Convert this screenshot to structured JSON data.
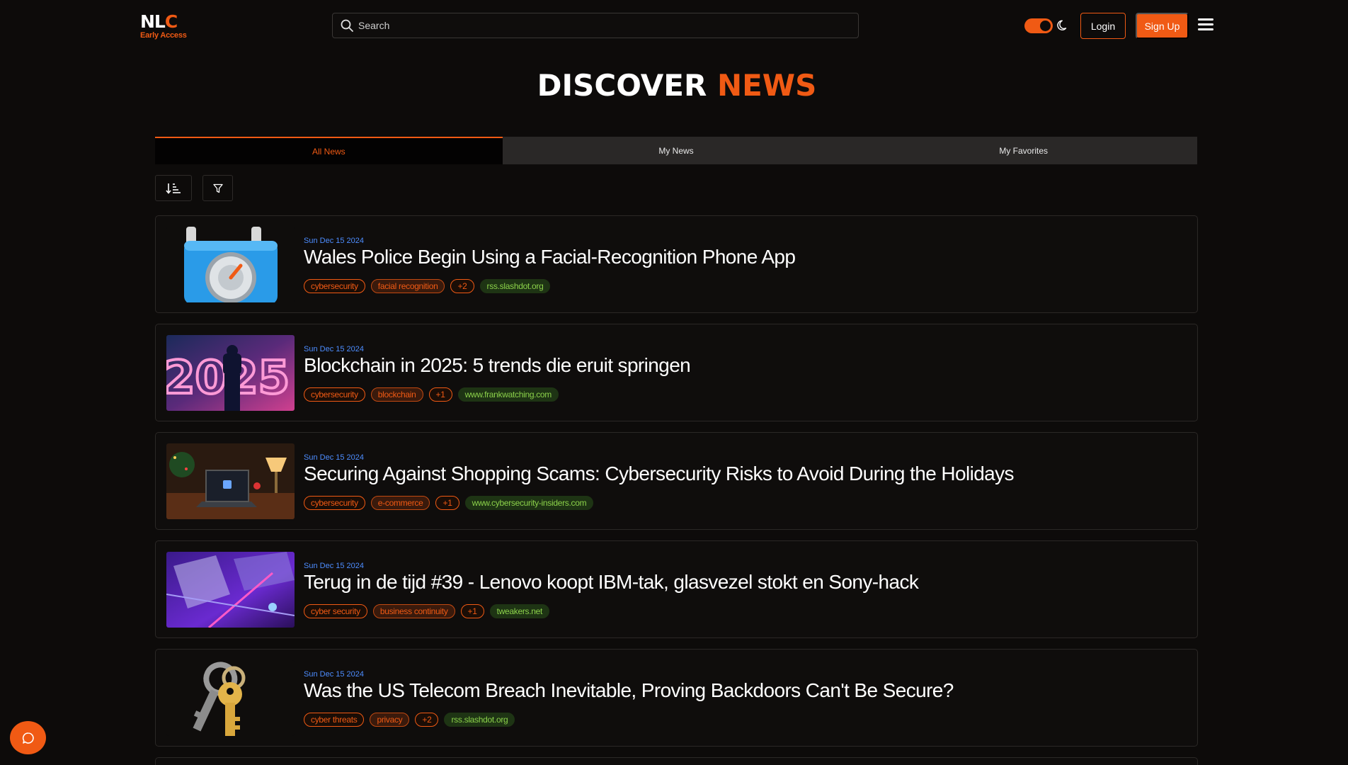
{
  "header": {
    "logo_main_1": "NL",
    "logo_main_2": "C",
    "logo_sub": "Early Access",
    "search_placeholder": "Search",
    "login_label": "Login",
    "signup_label": "Sign Up"
  },
  "page": {
    "title_1": "DISCOVER",
    "title_2": "NEWS"
  },
  "tabs": [
    {
      "label": "All News",
      "active": true
    },
    {
      "label": "My News",
      "active": false
    },
    {
      "label": "My Favorites",
      "active": false
    }
  ],
  "articles": [
    {
      "date": "Sun Dec 15 2024",
      "title": "Wales Police Begin Using a Facial-Recognition Phone App",
      "tags": [
        "cybersecurity",
        "facial recognition"
      ],
      "more": "+2",
      "source": "rss.slashdot.org",
      "thumb": "padlock-icon"
    },
    {
      "date": "Sun Dec 15 2024",
      "title": "Blockchain in 2025: 5 trends die eruit springen",
      "tags": [
        "cybersecurity",
        "blockchain"
      ],
      "more": "+1",
      "source": "www.frankwatching.com",
      "thumb": "2025-neon-photo"
    },
    {
      "date": "Sun Dec 15 2024",
      "title": "Securing Against Shopping Scams: Cybersecurity Risks to Avoid During the Holidays",
      "tags": [
        "cybersecurity",
        "e-commerce"
      ],
      "more": "+1",
      "source": "www.cybersecurity-insiders.com",
      "thumb": "laptop-holiday-photo"
    },
    {
      "date": "Sun Dec 15 2024",
      "title": "Terug in de tijd #39 - Lenovo koopt IBM-tak, glasvezel stokt en Sony-hack",
      "tags": [
        "cyber security",
        "business continuity"
      ],
      "more": "+1",
      "source": "tweakers.net",
      "thumb": "purple-servers-photo"
    },
    {
      "date": "Sun Dec 15 2024",
      "title": "Was the US Telecom Breach Inevitable, Proving Backdoors Can't Be Secure?",
      "tags": [
        "cyber threats",
        "privacy"
      ],
      "more": "+2",
      "source": "rss.slashdot.org",
      "thumb": "keys-icon"
    }
  ],
  "colors": {
    "accent": "#f05a14",
    "date_blue": "#4d8dff",
    "source_green": "#8bd14a",
    "background": "#0d0b0a"
  }
}
